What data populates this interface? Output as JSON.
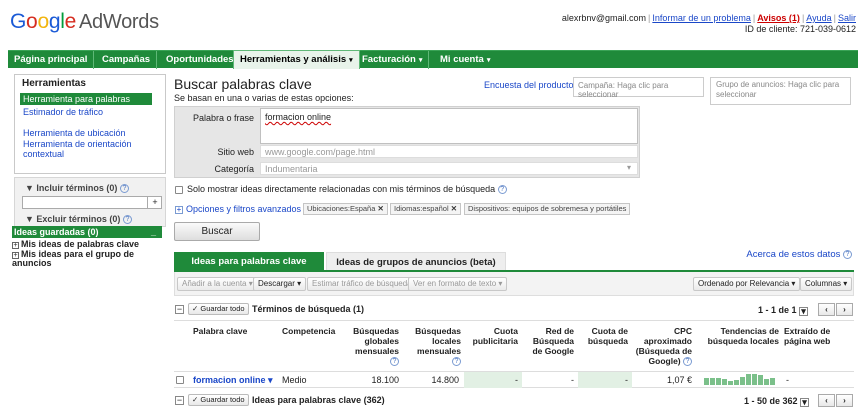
{
  "header": {
    "logo_letters": [
      "G",
      "o",
      "o",
      "g",
      "l",
      "e"
    ],
    "logo_product": "AdWords",
    "email": "alexrbnv@gmail.com",
    "report_problem": "Informar de un problema",
    "alerts": "Avisos (1)",
    "help": "Ayuda",
    "exit": "Salir",
    "client_id": "ID de cliente: 721-039-0612"
  },
  "nav": {
    "items": [
      {
        "label": "Página principal",
        "caret": false
      },
      {
        "label": "Campañas",
        "caret": false
      },
      {
        "label": "Oportunidades",
        "caret": false
      },
      {
        "label": "Herramientas y análisis",
        "caret": true,
        "active": true
      },
      {
        "label": "Facturación",
        "caret": true
      },
      {
        "label": "Mi cuenta",
        "caret": true
      }
    ],
    "caret": "▾",
    "color": "#1f8a3a"
  },
  "sidebar": {
    "heading": "Herramientas",
    "items": [
      {
        "label": "Herramienta para palabras clave",
        "selected": true
      },
      {
        "label": "Estimador de tráfico"
      },
      {
        "label": "Herramienta de ubicación"
      },
      {
        "label": "Herramienta de orientación contextual"
      }
    ],
    "include_terms": "▼ Incluir términos (0)",
    "exclude_terms": "▼ Excluir términos (0)",
    "plus": "+",
    "help_glyph": "?",
    "saved_ideas": "Ideas guardadas (0)",
    "saved_min": "_",
    "saved_items": [
      "Mis ideas de palabras clave",
      "Mis ideas para el grupo de anuncios"
    ],
    "expand_glyph": "+"
  },
  "main": {
    "title": "Buscar palabras clave",
    "subtitle": "Se basan en una o varias de estas opciones:",
    "survey_link": "Encuesta del producto",
    "campaign_placeholder": "Campaña: Haga clic para seleccionar",
    "adgroup_placeholder": "Grupo de anuncios: Haga clic para seleccionar",
    "form": {
      "word_label": "Palabra o frase",
      "word_value": "formacion online",
      "site_label": "Sitio web",
      "site_placeholder": "www.google.com/page.html",
      "category_label": "Categoría",
      "category_value": "Indumentaria",
      "dropdown_glyph": "▾"
    },
    "only_related": "Solo mostrar ideas directamente relacionadas con mis términos de búsqueda",
    "help_glyph": "?",
    "advanced": "Opciones y filtros avanzados",
    "advanced_glyph": "+",
    "chips": [
      {
        "key": "Ubicaciones:",
        "value": "España",
        "x": "✕"
      },
      {
        "key": "Idiomas:",
        "value": "español",
        "x": "✕"
      },
      {
        "key": "Dispositivos:",
        "value": "equipos de sobremesa y portátiles",
        "x": ""
      }
    ],
    "search_button": "Buscar",
    "tab_keywords": "Ideas para palabras clave",
    "tab_groups": "Ideas de grupos de anuncios (beta)",
    "about_data": "Acerca de estos datos"
  },
  "toolbar": {
    "add_account": "Añadir a la cuenta ▾",
    "download": "Descargar ▾",
    "estimate": "Estimar tráfico de búsqueda",
    "text_format": "Ver en formato de texto ▾",
    "sort": "Ordenado por Relevancia ▾",
    "columns": "Columnas ▾"
  },
  "results": {
    "save_all": "✓ Guardar todo",
    "minus_glyph": "−",
    "search_terms_title": "Términos de búsqueda (1)",
    "pager1": "1 - 1 de 1",
    "prev": "‹",
    "next": "›",
    "pager_dd": "▾",
    "columns": [
      "Palabra clave",
      "Competencia",
      "Búsquedas globales mensuales",
      "Búsquedas locales mensuales",
      "Cuota publicitaria",
      "Red de Búsqueda de Google",
      "Cuota de búsqueda",
      "CPC aproximado (Búsqueda de Google)",
      "Tendencias de búsqueda locales",
      "Extraído de página web"
    ],
    "row": {
      "keyword": "formacion online",
      "keyword_dd": "▾",
      "competition": "Medio",
      "global": "18.100",
      "local": "14.800",
      "ad_share": "-",
      "search_net": "-",
      "search_share": "-",
      "cpc": "1,07 €",
      "extracted": "-",
      "trend": [
        0.55,
        0.6,
        0.6,
        0.5,
        0.35,
        0.45,
        0.7,
        0.9,
        0.95,
        0.8,
        0.5,
        0.55
      ]
    },
    "ideas_title": "Ideas para palabras clave (362)",
    "pager2": "1 - 50 de 362"
  }
}
